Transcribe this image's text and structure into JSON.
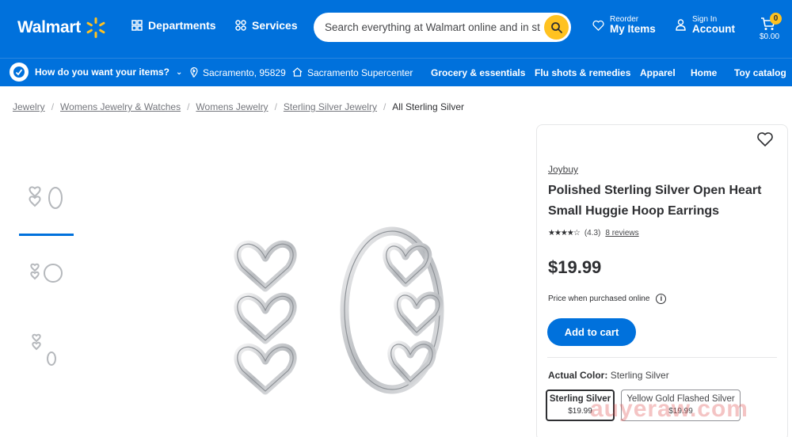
{
  "header": {
    "logo_text": "Walmart",
    "departments_label": "Departments",
    "services_label": "Services",
    "search_placeholder": "Search everything at Walmart online and in st",
    "reorder_small": "Reorder",
    "reorder_big": "My Items",
    "signin_small": "Sign In",
    "signin_big": "Account",
    "cart_count": "0",
    "cart_total": "$0.00",
    "brand_color": "#0071dc",
    "accent_color": "#ffc220"
  },
  "nav": {
    "how_label": "How do you want your items?",
    "location": "Sacramento, 95829",
    "store": "Sacramento Supercenter",
    "links": [
      "Grocery & essentials",
      "Flu shots & remedies",
      "Apparel",
      "Home",
      "Toy catalog"
    ]
  },
  "breadcrumb": {
    "items": [
      "Jewelry",
      "Womens Jewelry & Watches",
      "Womens Jewelry",
      "Sterling Silver Jewelry"
    ],
    "current": "All Sterling Silver"
  },
  "product": {
    "brand": "Joybuy",
    "title": "Polished Sterling Silver Open Heart Small Huggie Hoop Earrings",
    "rating_value": "(4.3)",
    "reviews_label": "8 reviews",
    "rating_stars": 4.3,
    "price": "$19.99",
    "price_note": "Price when purchased online",
    "add_to_cart": "Add to cart",
    "color_label": "Actual Color:",
    "color_value": "Sterling Silver",
    "swatches": [
      {
        "name": "Sterling Silver",
        "price": "$19.99"
      },
      {
        "name": "Yellow Gold Flashed Silver",
        "price": "$19.99"
      }
    ]
  },
  "watermark": "auyeraw.com"
}
